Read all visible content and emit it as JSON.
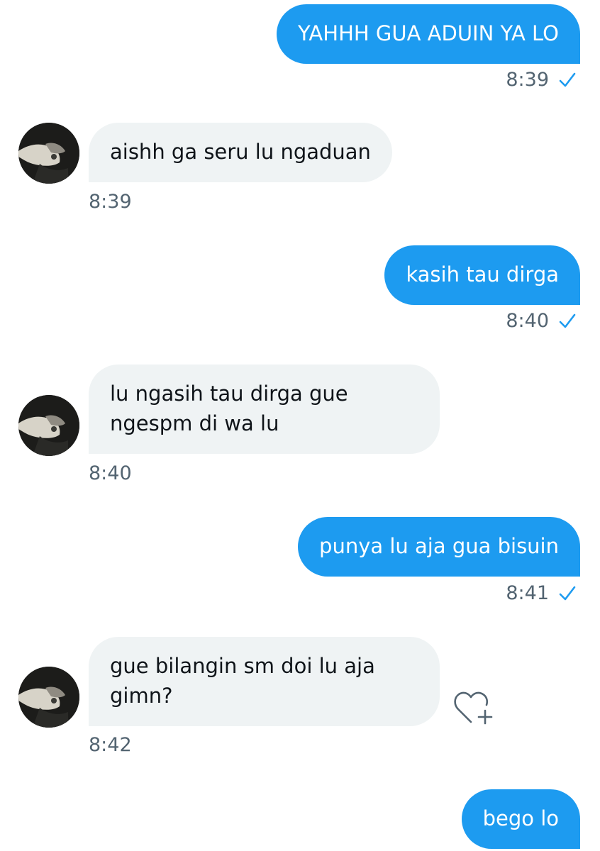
{
  "messages": [
    {
      "side": "sent",
      "text": "YAHHH GUA ADUIN YA LO",
      "time": "8:39"
    },
    {
      "side": "received",
      "text": "aishh ga seru lu ngaduan",
      "time": "8:39"
    },
    {
      "side": "sent",
      "text": "kasih tau dirga",
      "time": "8:40"
    },
    {
      "side": "received",
      "lines": [
        "lu ngasih tau dirga gue",
        "ngespm di wa lu"
      ],
      "time": "8:40"
    },
    {
      "side": "sent",
      "text": "punya lu aja gua bisuin",
      "time": "8:41"
    },
    {
      "side": "received",
      "lines": [
        "gue bilangin sm doi lu aja",
        "gimn?"
      ],
      "time": "8:42"
    },
    {
      "side": "sent",
      "text": "bego lo"
    }
  ],
  "colors": {
    "sent_bubble": "#1d9bf0",
    "received_bubble": "#eff3f4",
    "timestamp": "#536471",
    "read_check": "#1d9bf0"
  },
  "icons": {
    "read_receipt": "check-icon",
    "add_reaction": "heart-plus-icon"
  }
}
